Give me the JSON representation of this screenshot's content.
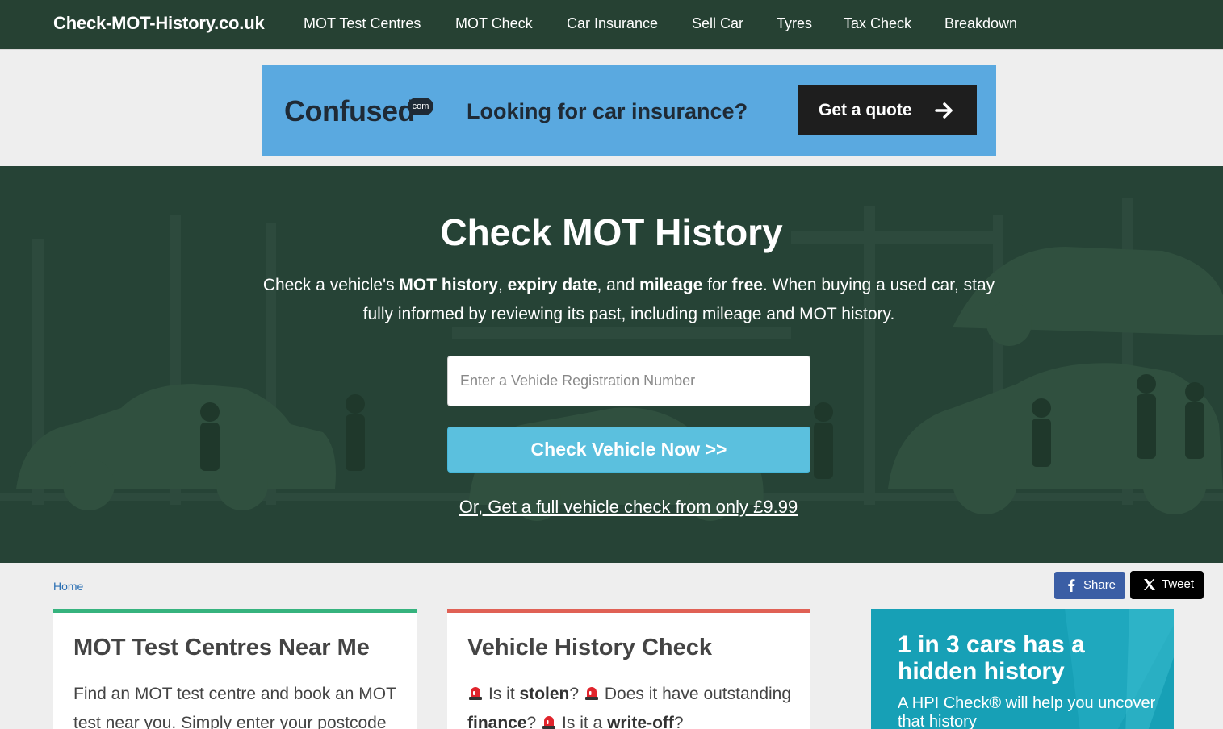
{
  "nav": {
    "brand": "Check-MOT-History.co.uk",
    "links": [
      "MOT Test Centres",
      "MOT Check",
      "Car Insurance",
      "Sell Car",
      "Tyres",
      "Tax Check",
      "Breakdown"
    ]
  },
  "ad": {
    "logo": "Confused",
    "logo_suffix": "com",
    "text": "Looking for car insurance?",
    "button_label": "Get a quote",
    "background": "#5aa9e0"
  },
  "hero": {
    "title": "Check MOT History",
    "desc_part1": "Check a vehicle's ",
    "desc_bold1": "MOT history",
    "desc_part2": ", ",
    "desc_bold2": "expiry date",
    "desc_part3": ", and ",
    "desc_bold3": "mileage",
    "desc_part4": " for ",
    "desc_bold4": "free",
    "desc_part5": ". When buying a used car, stay fully informed by reviewing its past, including mileage and MOT history.",
    "input_placeholder": "Enter a Vehicle Registration Number",
    "button_label": "Check Vehicle Now >>",
    "full_check_link": "Or, Get a full vehicle check from only £9.99",
    "background": "#264336",
    "button_color": "#5bc0de"
  },
  "breadcrumb": {
    "home": "Home"
  },
  "social": {
    "share_label": "Share",
    "tweet_label": "Tweet"
  },
  "cards": {
    "mot_centres": {
      "title": "MOT Test Centres Near Me",
      "text": "Find an MOT test centre and book an MOT test near you. Simply enter your postcode",
      "accent": "#36b37e"
    },
    "history_check": {
      "title": "Vehicle History Check",
      "q1_pre": "Is it ",
      "q1_bold": "stolen",
      "q1_post": "? ",
      "q2_pre": "Does it have outstanding ",
      "q2_bold": "finance",
      "q2_post": "? ",
      "q3_pre": "Is it a ",
      "q3_bold": "write-off",
      "q3_post": "?",
      "accent": "#e06155"
    }
  },
  "hpi": {
    "title": "1 in 3 cars has a hidden history",
    "subtitle": "A HPI Check® will help you uncover that history",
    "background": "#17a0b6"
  }
}
